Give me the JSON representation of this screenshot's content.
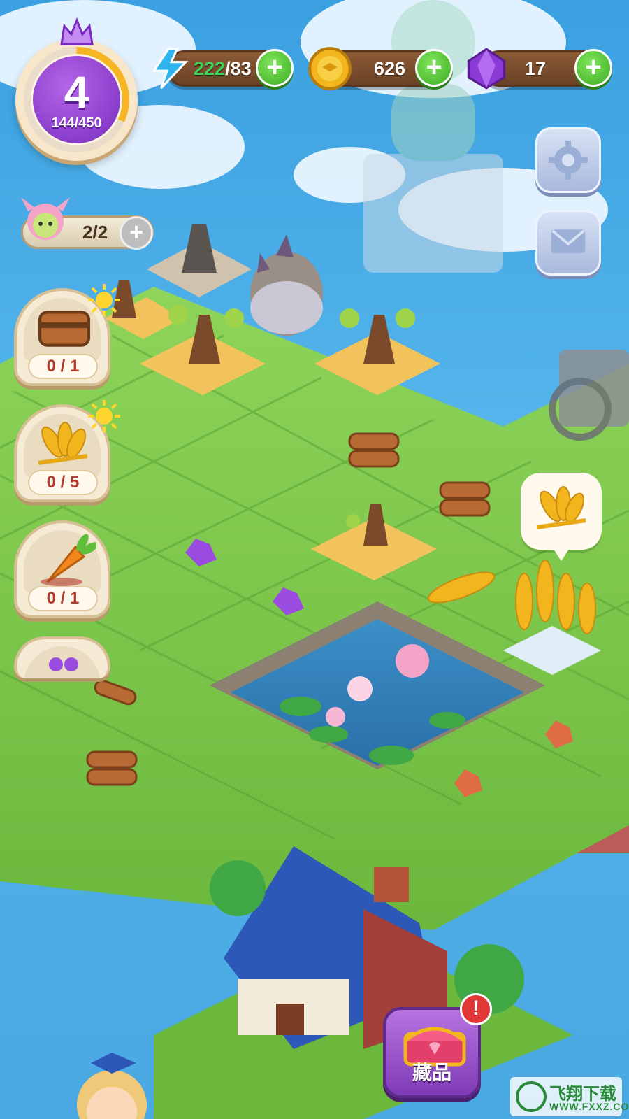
{
  "hud": {
    "level": "4",
    "xp": "144/450",
    "xp_fraction": 0.32,
    "energy": {
      "current": "222",
      "max": "/83"
    },
    "coins": "626",
    "gems": "17",
    "plus_symbol": "+"
  },
  "helper": {
    "count": "2/2"
  },
  "tasks": [
    {
      "icon": "wooden-barrel-icon",
      "progress": "0 / 1"
    },
    {
      "icon": "wheat-icon",
      "progress": "0 / 5"
    },
    {
      "icon": "carrot-icon",
      "progress": "0 / 1"
    }
  ],
  "collection_button": {
    "label": "藏品",
    "alert": "!"
  },
  "watermark": {
    "main": "飞翔下载",
    "sub": "WWW.FXXZ.COM"
  },
  "colors": {
    "sky": "#4aa8e2",
    "grass": "#7cc84a",
    "level_purple": "#7a2cc0",
    "plus_green": "#3fae22",
    "energy_blue": "#2fb5ee",
    "energy_green": "#3ed15a",
    "coin_gold": "#f2b51d",
    "gem_purple": "#8b3ad6"
  }
}
